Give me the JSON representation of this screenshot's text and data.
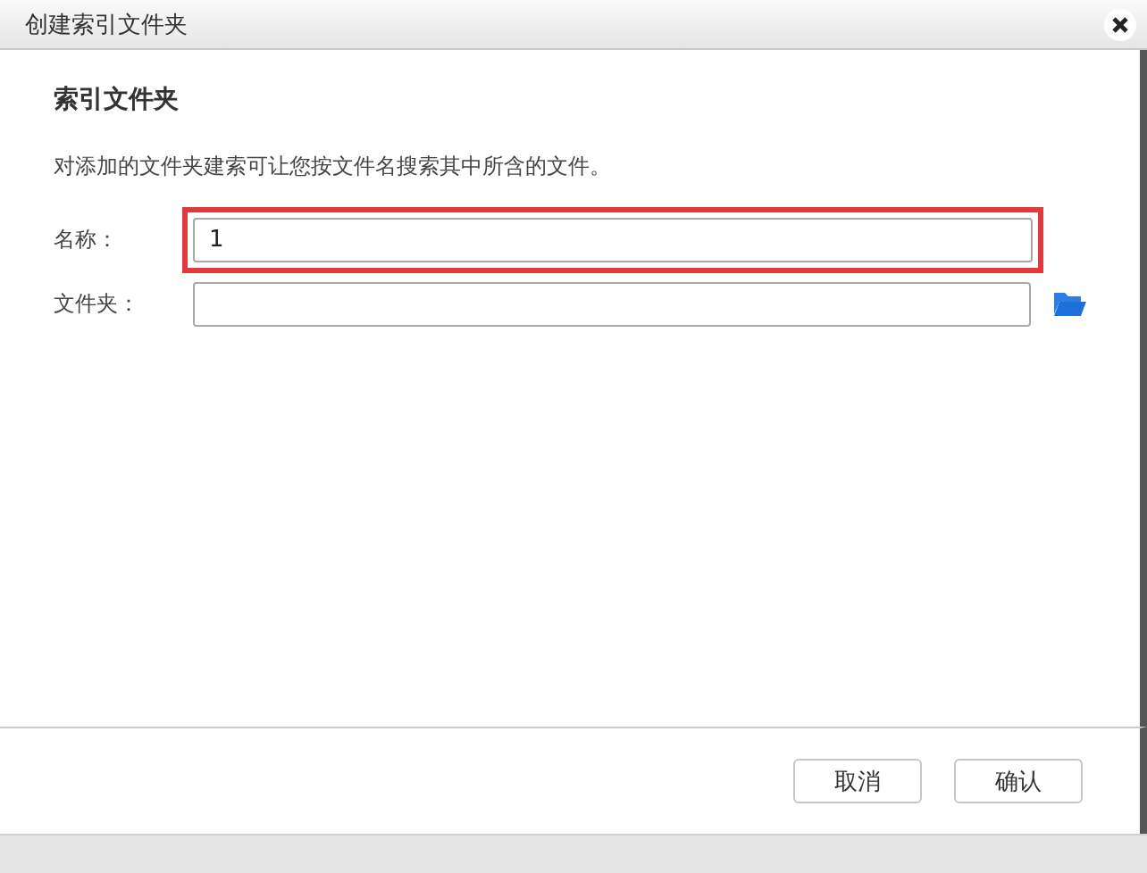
{
  "window": {
    "title": "创建索引文件夹"
  },
  "section": {
    "heading": "索引文件夹",
    "description": "对添加的文件夹建索可让您按文件名搜索其中所含的文件。"
  },
  "fields": [
    {
      "kind": "text",
      "label": "名称：",
      "value": "1",
      "highlighted": true
    },
    {
      "kind": "folder",
      "label": "文件夹：",
      "highlighted": false
    }
  ],
  "buttons": [
    "取消",
    "确认"
  ]
}
